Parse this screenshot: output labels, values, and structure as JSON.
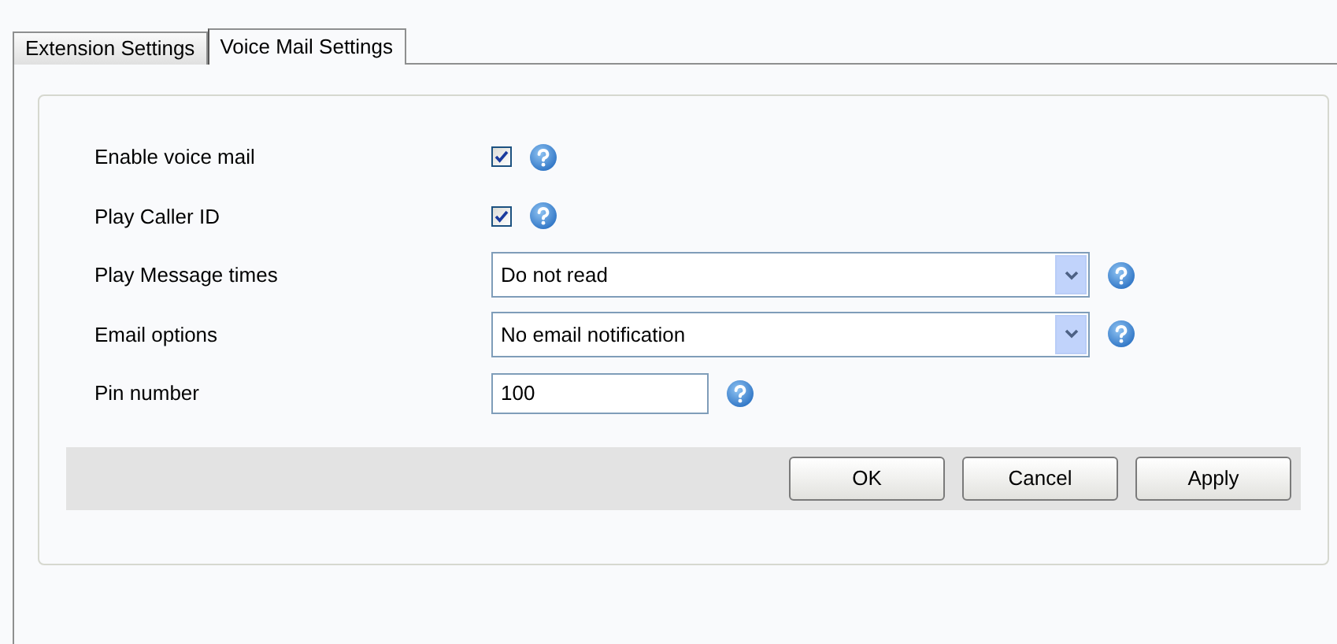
{
  "tabs": [
    {
      "label": "Extension Settings",
      "selected": false
    },
    {
      "label": "Voice Mail Settings",
      "selected": true
    }
  ],
  "fields": [
    {
      "kind": "checkbox",
      "label": "Enable voice mail",
      "checked": true
    },
    {
      "kind": "checkbox",
      "label": "Play Caller ID",
      "checked": true
    },
    {
      "kind": "select",
      "label": "Play Message times",
      "value": "Do not read"
    },
    {
      "kind": "select",
      "label": "Email options",
      "value": "No email notification"
    },
    {
      "kind": "text",
      "label": "Pin number",
      "value": "100"
    }
  ],
  "buttons": [
    "OK",
    "Cancel",
    "Apply"
  ]
}
